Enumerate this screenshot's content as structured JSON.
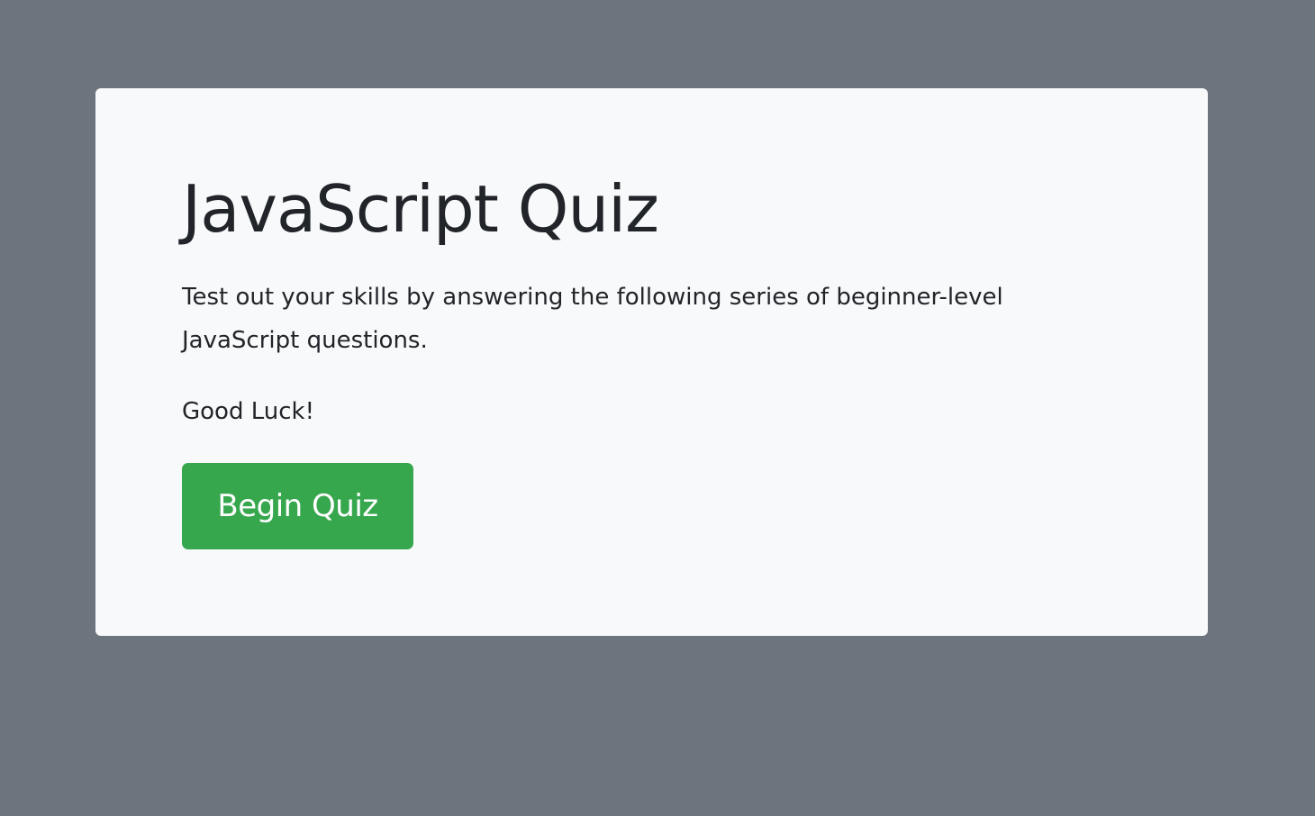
{
  "quiz": {
    "title": "JavaScript Quiz",
    "description": "Test out your skills by answering the following series of beginner-level JavaScript questions.",
    "good_luck": "Good Luck!",
    "begin_label": "Begin Quiz"
  },
  "colors": {
    "background": "#6c757d",
    "card": "#f8f9fa",
    "text": "#212529",
    "button": "#37a74e",
    "button_text": "#ffffff"
  }
}
